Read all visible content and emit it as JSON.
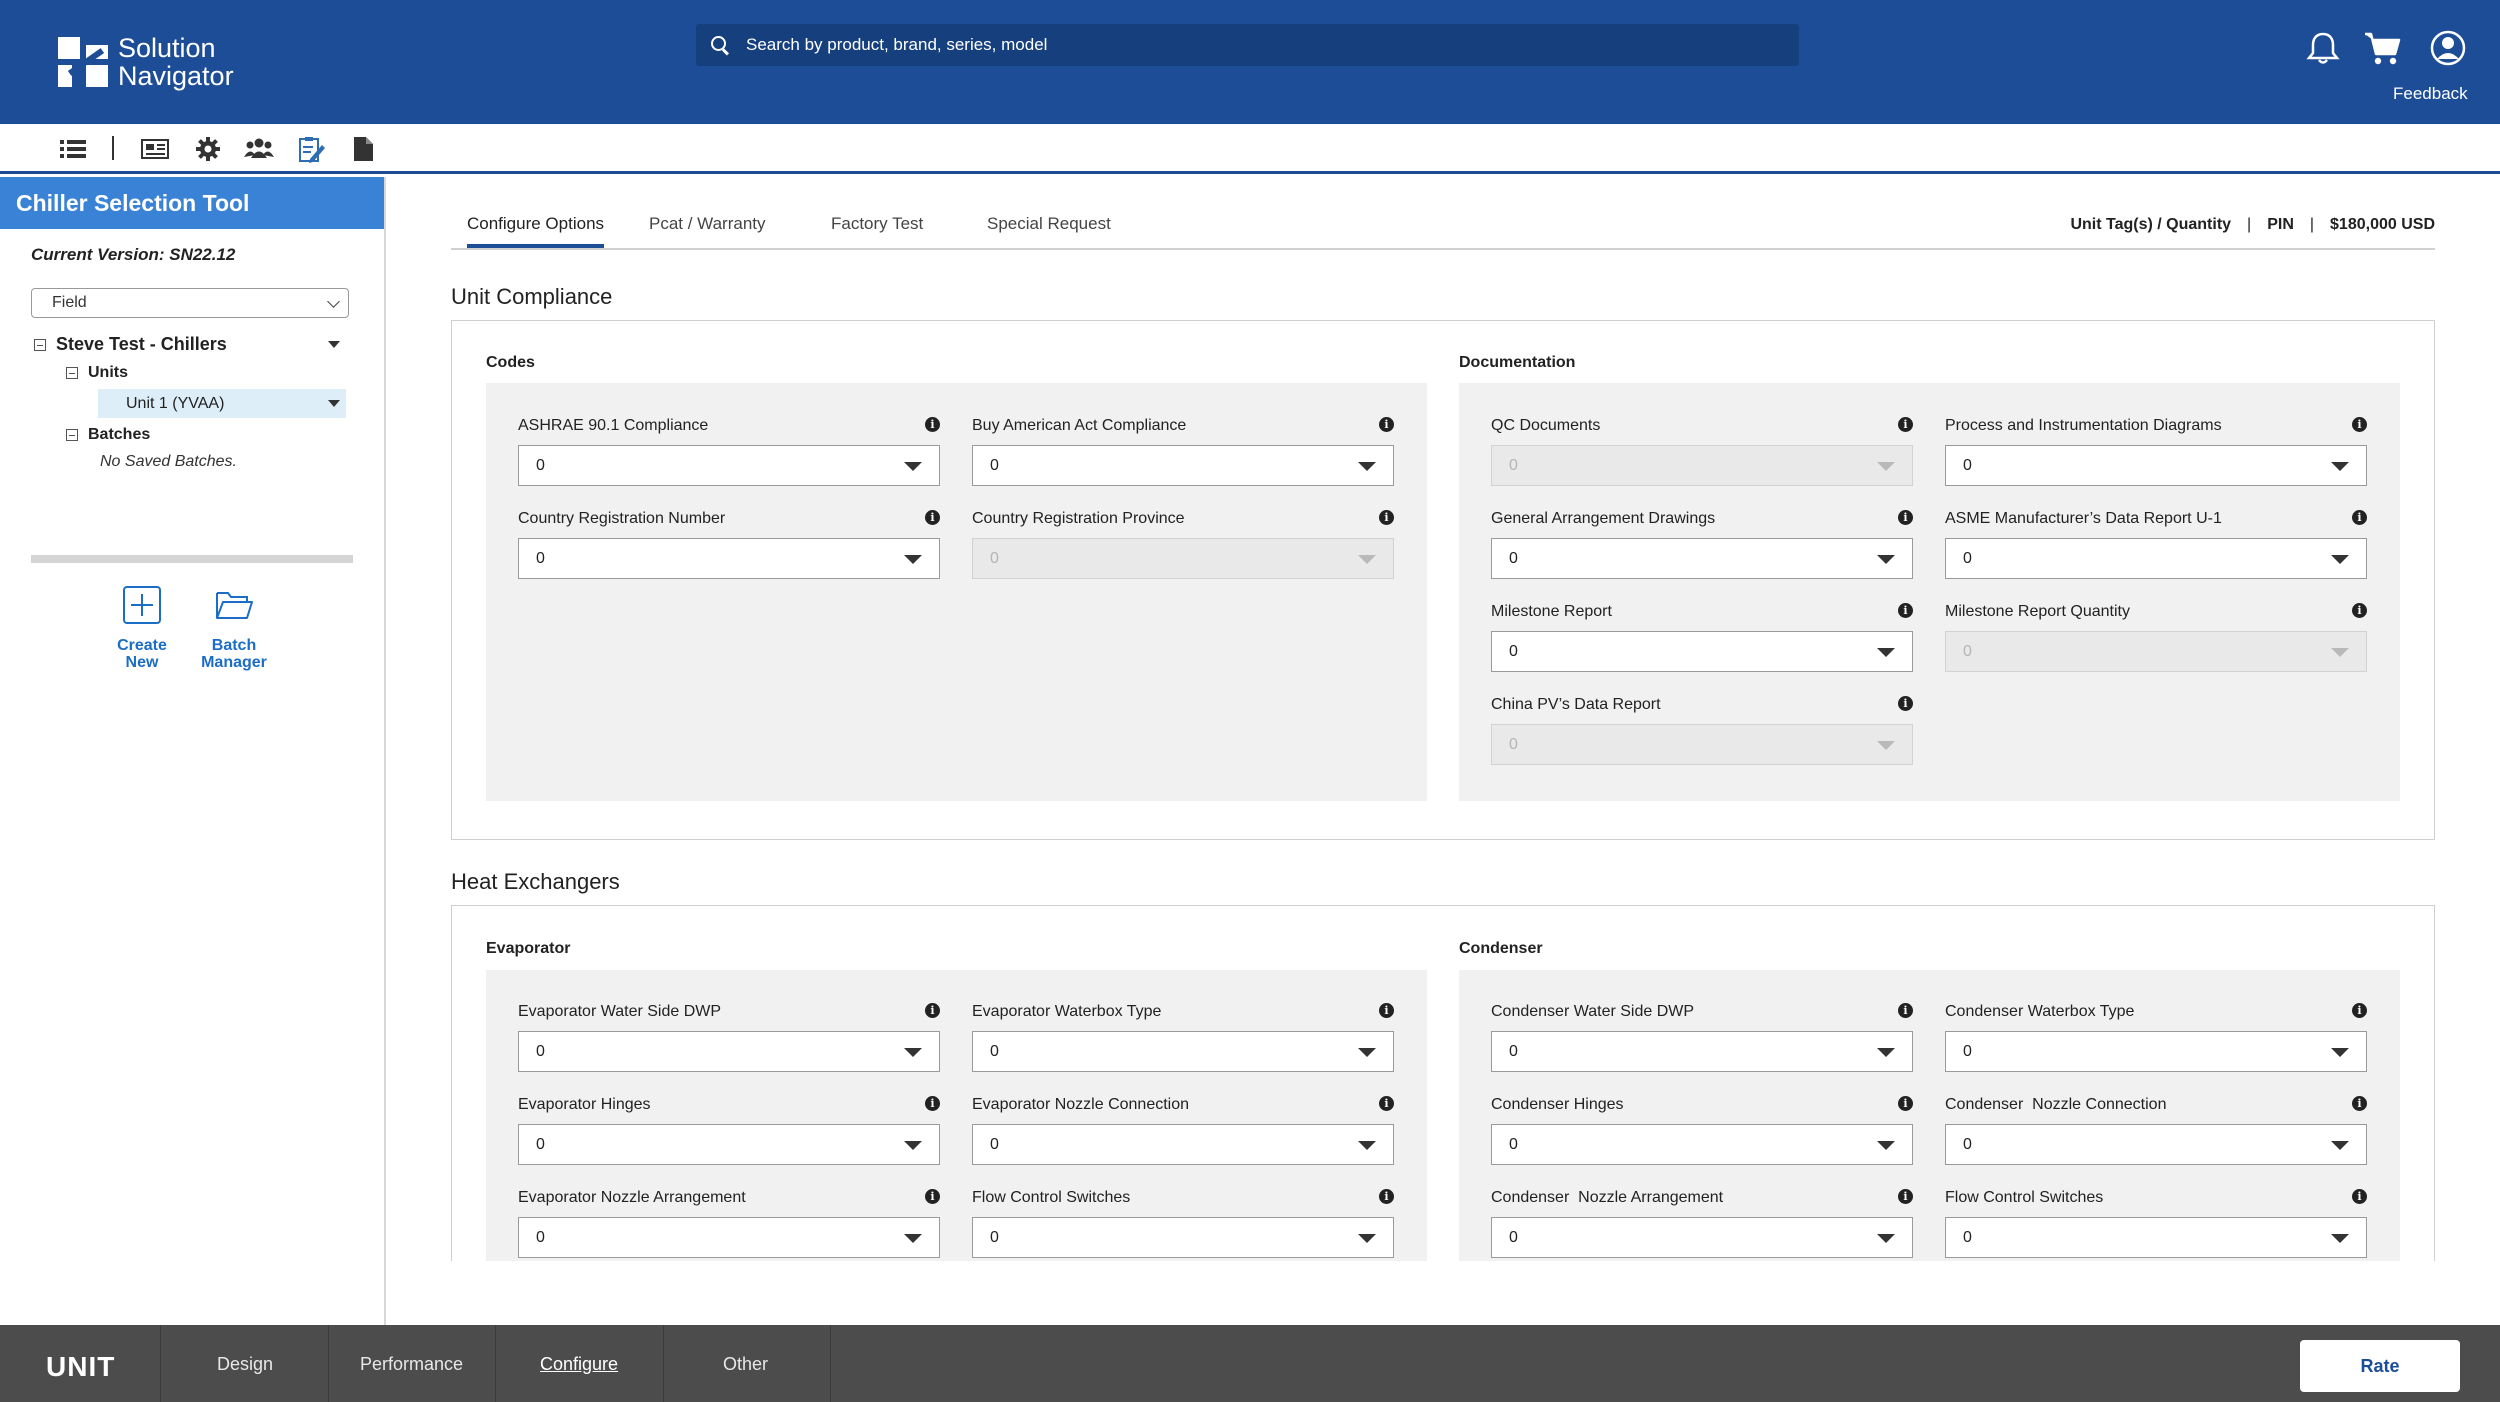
{
  "header": {
    "logo_line1": "Solution",
    "logo_line2": "Navigator",
    "search_placeholder": "Search by product, brand, series, model",
    "feedback_label": "Feedback",
    "brand_color": "#1c4d96"
  },
  "toolbar": {
    "icons": [
      "list-icon",
      "newspaper-icon",
      "gear-icon",
      "users-icon",
      "clipboard-edit-icon",
      "document-icon"
    ]
  },
  "sidebar": {
    "title": "Chiller Selection Tool",
    "version": "Current Version: SN22.12",
    "field_select_value": "Field",
    "project": "Steve Test - Chillers",
    "units_label": "Units",
    "unit_item": "Unit 1 (YVAA)",
    "batches_label": "Batches",
    "no_batches": "No Saved Batches.",
    "create_new_line1": "Create",
    "create_new_line2": "New",
    "batch_manager_line1": "Batch",
    "batch_manager_line2": "Manager"
  },
  "tabs": {
    "items": [
      "Configure Options",
      "Pcat / Warranty",
      "Factory Test",
      "Special Request"
    ],
    "active": "Configure Options",
    "right_tag": "Unit Tag(s) / Quantity",
    "right_pin": "PIN",
    "right_price": "$180,000 USD"
  },
  "unit_compliance": {
    "title": "Unit Compliance",
    "codes": {
      "title": "Codes",
      "fields": [
        {
          "label": "ASHRAE 90.1 Compliance",
          "value": "0",
          "disabled": false
        },
        {
          "label": "Buy American Act Compliance",
          "value": "0",
          "disabled": false
        },
        {
          "label": "Country Registration Number",
          "value": "0",
          "disabled": false
        },
        {
          "label": "Country Registration Province",
          "value": "0",
          "disabled": true
        }
      ]
    },
    "documentation": {
      "title": "Documentation",
      "fields": [
        {
          "label": "QC Documents",
          "value": "0",
          "disabled": true
        },
        {
          "label": "Process and Instrumentation Diagrams",
          "value": "0",
          "disabled": false
        },
        {
          "label": "General Arrangement Drawings",
          "value": "0",
          "disabled": false
        },
        {
          "label": "ASME Manufacturer’s Data Report U-1",
          "value": "0",
          "disabled": false
        },
        {
          "label": "Milestone Report",
          "value": "0",
          "disabled": false
        },
        {
          "label": "Milestone Report Quantity",
          "value": "0",
          "disabled": true
        },
        {
          "label": "China PV’s Data Report",
          "value": "0",
          "disabled": true
        }
      ]
    }
  },
  "heat_exchangers": {
    "title": "Heat Exchangers",
    "evaporator": {
      "title": "Evaporator",
      "fields": [
        {
          "label": "Evaporator Water Side DWP",
          "value": "0",
          "disabled": false
        },
        {
          "label": "Evaporator Waterbox Type",
          "value": "0",
          "disabled": false
        },
        {
          "label": "Evaporator Hinges",
          "value": "0",
          "disabled": false
        },
        {
          "label": "Evaporator Nozzle Connection",
          "value": "0",
          "disabled": false
        },
        {
          "label": "Evaporator Nozzle Arrangement",
          "value": "0",
          "disabled": false
        },
        {
          "label": "Flow Control Switches",
          "value": "0",
          "disabled": false
        }
      ]
    },
    "condenser": {
      "title": "Condenser",
      "fields": [
        {
          "label": "Condenser Water Side DWP",
          "value": "0",
          "disabled": false
        },
        {
          "label": "Condenser Waterbox Type",
          "value": "0",
          "disabled": false
        },
        {
          "label": "Condenser Hinges",
          "value": "0",
          "disabled": false
        },
        {
          "label": "Condenser  Nozzle Connection",
          "value": "0",
          "disabled": false
        },
        {
          "label": "Condenser  Nozzle Arrangement",
          "value": "0",
          "disabled": false
        },
        {
          "label": "Flow Control Switches",
          "value": "0",
          "disabled": false
        }
      ]
    }
  },
  "bottombar": {
    "unit_label": "UNIT",
    "tabs": [
      "Design",
      "Performance",
      "Configure",
      "Other"
    ],
    "active": "Configure",
    "rate_label": "Rate"
  }
}
